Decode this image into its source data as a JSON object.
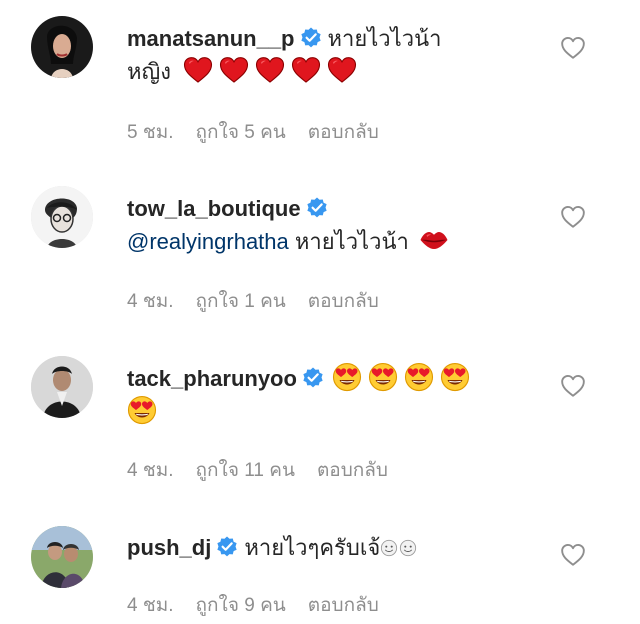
{
  "comments": [
    {
      "username": "manatsanun__p",
      "verified": true,
      "text_line1": "หายไวไวน้า",
      "text_line2_prefix": "หญิง",
      "emoji_icons": [
        "red-heart-icon",
        "red-heart-icon",
        "red-heart-icon",
        "red-heart-icon",
        "red-heart-icon"
      ],
      "time": "5 ชม.",
      "likes": "ถูกใจ 5 คน",
      "reply": "ตอบกลับ"
    },
    {
      "username": "tow_la_boutique",
      "verified": true,
      "mention": "@realyingrhatha",
      "text_line1": " หายไวไวน้า",
      "emoji_icons": [
        "kiss-lips-icon"
      ],
      "time": "4 ชม.",
      "likes": "ถูกใจ 1 คน",
      "reply": "ตอบกลับ"
    },
    {
      "username": "tack_pharunyoo",
      "verified": true,
      "emoji_icons": [
        "heart-eyes-face-icon",
        "heart-eyes-face-icon",
        "heart-eyes-face-icon",
        "heart-eyes-face-icon",
        "heart-eyes-face-icon"
      ],
      "time": "4 ชม.",
      "likes": "ถูกใจ 11 คน",
      "reply": "ตอบกลับ"
    },
    {
      "username": "push_dj",
      "verified": true,
      "text_line1": "หายไวๆครับเจ้",
      "emoji_icons": [
        "face-icon",
        "face-icon"
      ],
      "time": "4 ชม.",
      "likes": "ถูกใจ 9 คน",
      "reply": "ตอบกลับ"
    }
  ],
  "colors": {
    "verified_blue": "#3897f0",
    "meta_gray": "#8e8e8e",
    "text": "#262626",
    "mention": "#003569",
    "heart_red": "#ed1c24"
  }
}
